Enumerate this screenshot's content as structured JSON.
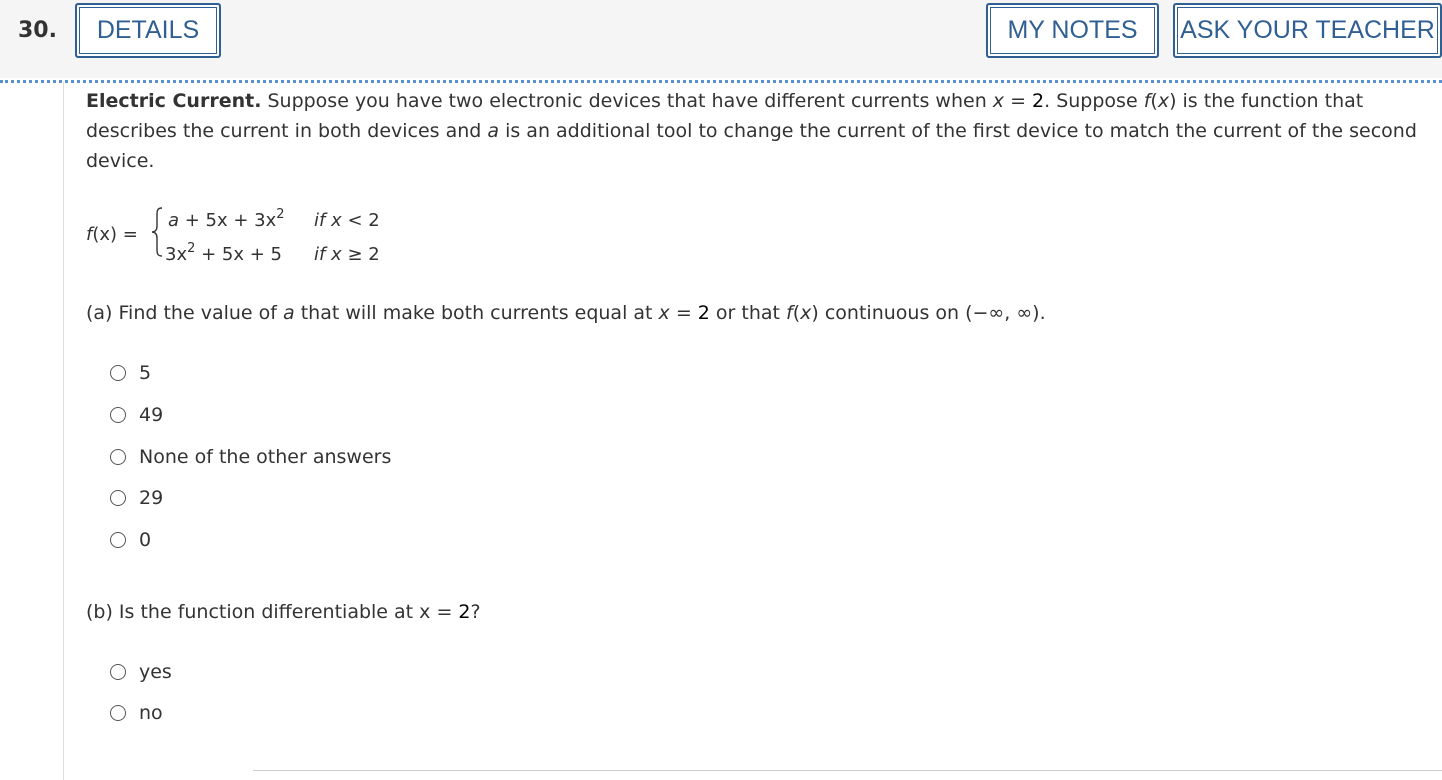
{
  "question": {
    "number": "30.",
    "details_button": "DETAILS",
    "my_notes_button": "MY NOTES",
    "ask_teacher_button": "ASK YOUR TEACHER"
  },
  "intro": {
    "title": "Electric Current.",
    "text1": " Suppose you have two electronic devices that have different currents when ",
    "var_x": "x",
    "eq": " = ",
    "num2": "2",
    "text2": ". Suppose ",
    "fx": "f",
    "fx_paren_open": "(",
    "fx_x": "x",
    "fx_paren_close": ")",
    "text3": " is the function that describes the current in both devices and ",
    "var_a": "a",
    "text4": " is an additional tool to change the current of the first device to match the current of the second device."
  },
  "function": {
    "label_f": "f",
    "label_rest": "(x) =",
    "case1_expr_a": "a",
    "case1_expr_rest": " + 5x + 3x",
    "case1_exp": "2",
    "case1_cond_if": "if x",
    "case1_cond_rest": " < 2",
    "case2_expr": "3x",
    "case2_exp": "2",
    "case2_expr_rest": " + 5x + 5",
    "case2_cond_if": "if x",
    "case2_cond_rest": " ≥ 2"
  },
  "part_a": {
    "prefix": "(a) Find the value of ",
    "var_a": "a",
    "mid1": " that will make both currents equal at ",
    "var_x": "x",
    "eq": " = ",
    "num2": "2",
    "mid2": " or that ",
    "f": "f",
    "fx_rest_open": "(",
    "fx_x": "x",
    "fx_rest_close": ")",
    "mid3": " continuous on ",
    "interval": "(−∞, ∞).",
    "options": [
      "5",
      "49",
      "None of the other answers",
      "29",
      "0"
    ]
  },
  "part_b": {
    "prefix": "(b) Is the function differentiable at x = ",
    "num2": "2",
    "suffix": "?",
    "options": [
      "yes",
      "no"
    ]
  },
  "colors": {
    "accent": "#2f5f93",
    "dotted_rule": "#5a8fd0",
    "header_bg": "#f5f5f5",
    "text": "#333333"
  }
}
